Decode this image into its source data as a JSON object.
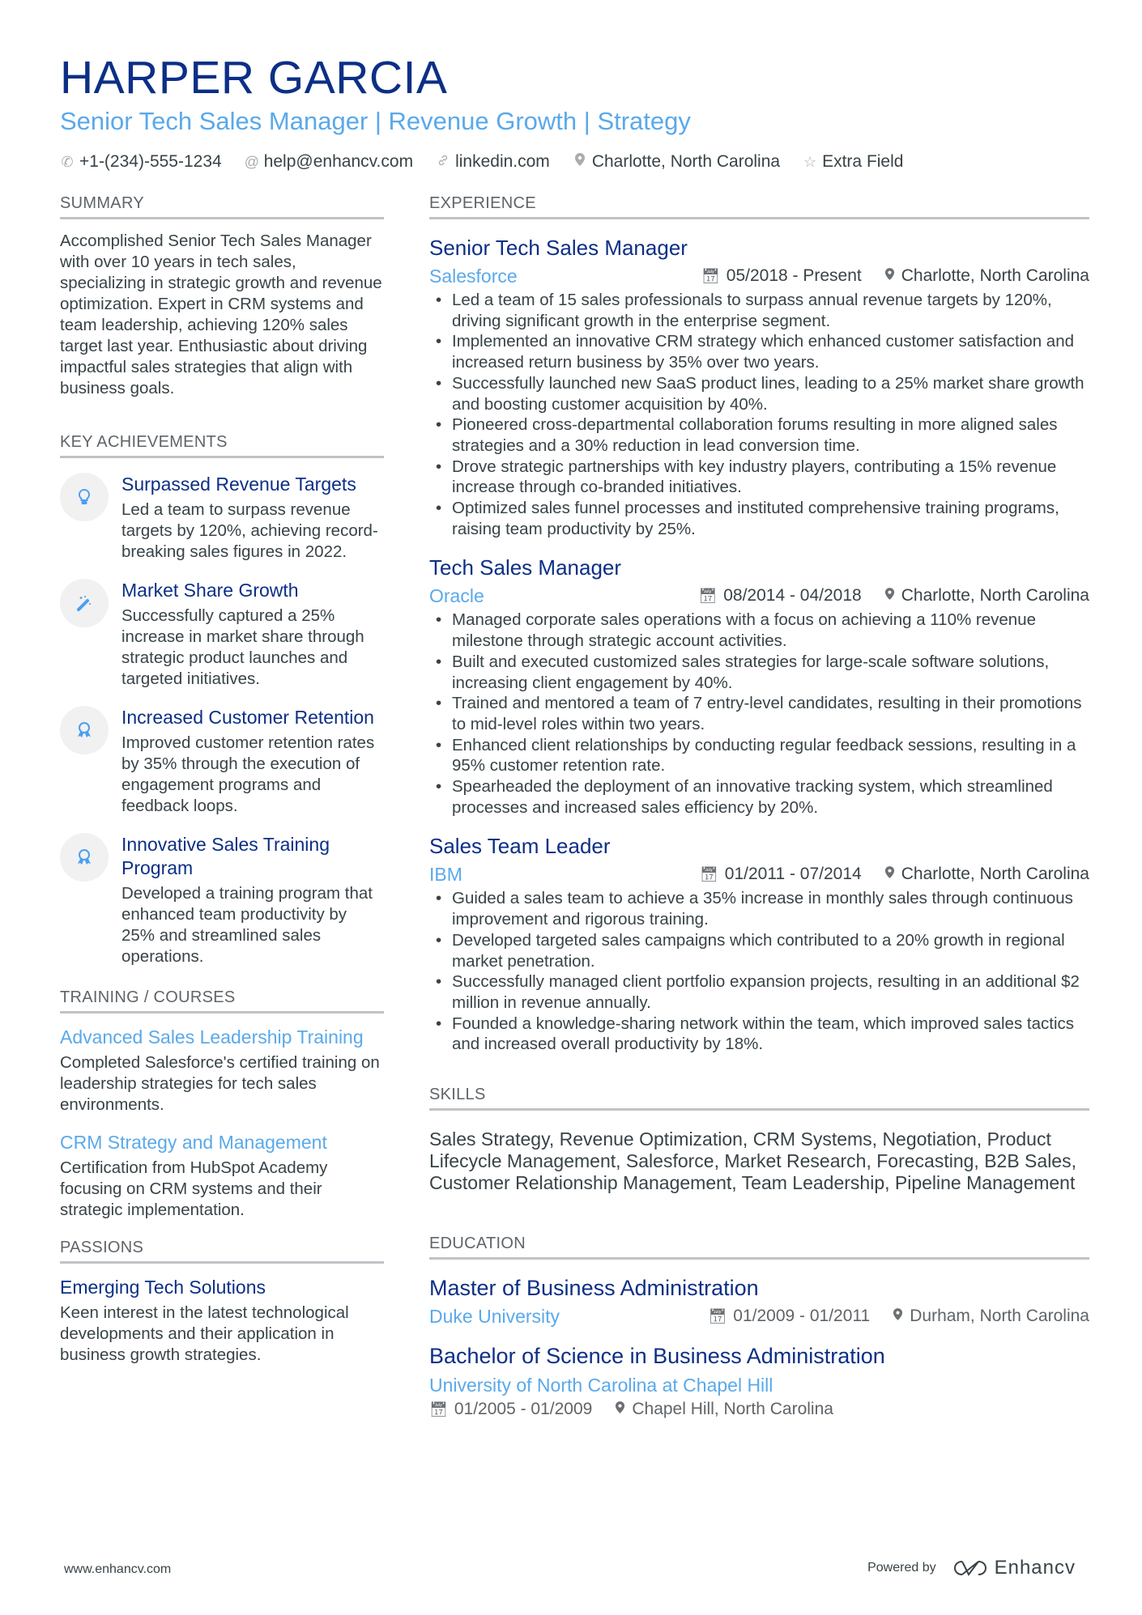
{
  "header": {
    "name": "HARPER GARCIA",
    "headline": "Senior Tech Sales Manager | Revenue Growth | Strategy",
    "contacts": [
      {
        "icon": "phone-icon",
        "text": "+1-(234)-555-1234"
      },
      {
        "icon": "at-icon",
        "text": "help@enhancv.com"
      },
      {
        "icon": "link-icon",
        "text": "linkedin.com"
      },
      {
        "icon": "location-icon",
        "text": "Charlotte, North Carolina"
      },
      {
        "icon": "star-icon",
        "text": "Extra Field"
      }
    ]
  },
  "summary": {
    "title": "SUMMARY",
    "text": "Accomplished Senior Tech Sales Manager with over 10 years in tech sales, specializing in strategic growth and revenue optimization. Expert in CRM systems and team leadership, achieving 120% sales target last year. Enthusiastic about driving impactful sales strategies that align with business goals."
  },
  "achievements": {
    "title": "KEY ACHIEVEMENTS",
    "items": [
      {
        "icon": "lightbulb-icon",
        "title": "Surpassed Revenue Targets",
        "text": "Led a team to surpass revenue targets by 120%, achieving record-breaking sales figures in 2022."
      },
      {
        "icon": "magic-wand-icon",
        "title": "Market Share Growth",
        "text": "Successfully captured a 25% increase in market share through strategic product launches and targeted initiatives."
      },
      {
        "icon": "award-icon",
        "title": "Increased Customer Retention",
        "text": "Improved customer retention rates by 35% through the execution of engagement programs and feedback loops."
      },
      {
        "icon": "award-icon",
        "title": "Innovative Sales Training Program",
        "text": "Developed a training program that enhanced team productivity by 25% and streamlined sales operations."
      }
    ]
  },
  "training": {
    "title": "TRAINING / COURSES",
    "items": [
      {
        "title": "Advanced Sales Leadership Training",
        "text": "Completed Salesforce's certified training on leadership strategies for tech sales environments."
      },
      {
        "title": "CRM Strategy and Management",
        "text": "Certification from HubSpot Academy focusing on CRM systems and their strategic implementation."
      }
    ]
  },
  "passions": {
    "title": "PASSIONS",
    "items": [
      {
        "title": "Emerging Tech Solutions",
        "text": "Keen interest in the latest technological developments and their application in business growth strategies."
      }
    ]
  },
  "experience": {
    "title": "EXPERIENCE",
    "jobs": [
      {
        "title": "Senior Tech Sales Manager",
        "company": "Salesforce",
        "dates": "05/2018 - Present",
        "location": "Charlotte, North Carolina",
        "bullets": [
          "Led a team of 15 sales professionals to surpass annual revenue targets by 120%, driving significant growth in the enterprise segment.",
          "Implemented an innovative CRM strategy which enhanced customer satisfaction and increased return business by 35% over two years.",
          "Successfully launched new SaaS product lines, leading to a 25% market share growth and boosting customer acquisition by 40%.",
          "Pioneered cross-departmental collaboration forums resulting in more aligned sales strategies and a 30% reduction in lead conversion time.",
          "Drove strategic partnerships with key industry players, contributing a 15% revenue increase through co-branded initiatives.",
          "Optimized sales funnel processes and instituted comprehensive training programs, raising team productivity by 25%."
        ]
      },
      {
        "title": "Tech Sales Manager",
        "company": "Oracle",
        "dates": "08/2014 - 04/2018",
        "location": "Charlotte, North Carolina",
        "bullets": [
          "Managed corporate sales operations with a focus on achieving a 110% revenue milestone through strategic account activities.",
          "Built and executed customized sales strategies for large-scale software solutions, increasing client engagement by 40%.",
          "Trained and mentored a team of 7 entry-level candidates, resulting in their promotions to mid-level roles within two years.",
          "Enhanced client relationships by conducting regular feedback sessions, resulting in a 95% customer retention rate.",
          "Spearheaded the deployment of an innovative tracking system, which streamlined processes and increased sales efficiency by 20%."
        ]
      },
      {
        "title": "Sales Team Leader",
        "company": "IBM",
        "dates": "01/2011 - 07/2014",
        "location": "Charlotte, North Carolina",
        "bullets": [
          "Guided a sales team to achieve a 35% increase in monthly sales through continuous improvement and rigorous training.",
          "Developed targeted sales campaigns which contributed to a 20% growth in regional market penetration.",
          "Successfully managed client portfolio expansion projects, resulting in an additional $2 million in revenue annually.",
          "Founded a knowledge-sharing network within the team, which improved sales tactics and increased overall productivity by 18%."
        ]
      }
    ]
  },
  "skills": {
    "title": "SKILLS",
    "text": "Sales Strategy, Revenue Optimization, CRM Systems, Negotiation, Product Lifecycle Management, Salesforce, Market Research, Forecasting, B2B Sales, Customer Relationship Management, Team Leadership, Pipeline Management"
  },
  "education": {
    "title": "EDUCATION",
    "items": [
      {
        "degree": "Master of Business Administration",
        "school": "Duke University",
        "dates": "01/2009 - 01/2011",
        "location": "Durham, North Carolina"
      },
      {
        "degree": "Bachelor of Science in Business Administration",
        "school": "University of North Carolina at Chapel Hill",
        "dates": "01/2005 - 01/2009",
        "location": "Chapel Hill, North Carolina"
      }
    ]
  },
  "footer": {
    "website": "www.enhancv.com",
    "powered_by": "Powered by",
    "brand": "Enhancv"
  },
  "colors": {
    "name": "#0c2f86",
    "accent": "#5aa9ea",
    "text": "#384347",
    "divider": "#c0c3c6"
  }
}
